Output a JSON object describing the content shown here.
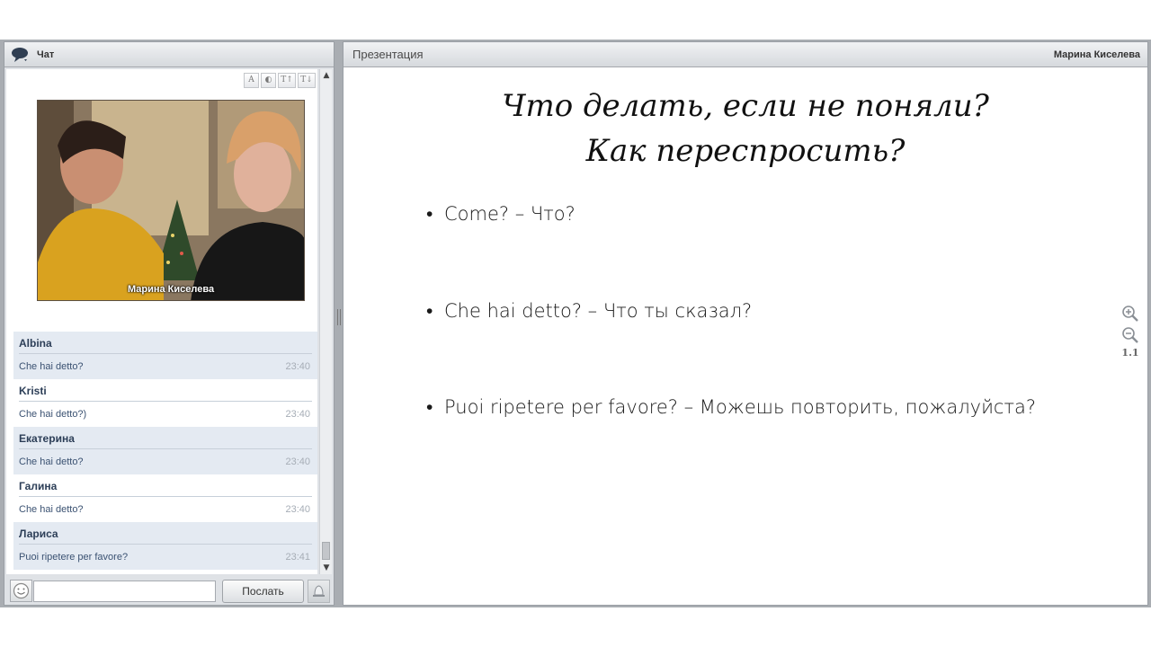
{
  "chat": {
    "title": "Чат",
    "tools": [
      "A",
      "◐",
      "T↑",
      "T↓"
    ],
    "video_name": "Марина Киселева",
    "messages": [
      {
        "author": "Albina",
        "text": "Che hai detto?",
        "time": "23:40"
      },
      {
        "author": "Kristi",
        "text": "Che hai detto?)",
        "time": "23:40"
      },
      {
        "author": "Екатерина",
        "text": "Che hai detto?",
        "time": "23:40"
      },
      {
        "author": "Галина",
        "text": "Che hai detto?",
        "time": "23:40"
      },
      {
        "author": "Лариса",
        "text": "Puoi ripetere per favore?",
        "time": "23:41"
      }
    ],
    "input_value": "",
    "send_label": "Послать",
    "icons": {
      "header": "speech-bubble-icon",
      "smiley": "smiley-icon",
      "bell": "bell-icon"
    }
  },
  "presentation": {
    "title": "Презентация",
    "presenter": "Марина Киселева",
    "slide": {
      "title_line1": "Что делать, если не поняли?",
      "title_line2": "Как переспросить?",
      "bullets": [
        "Come? – Что?",
        "Che hai detto? – Что ты сказал?",
        "Puoi ripetere per favore? – Можешь повторить, пожалуйста?"
      ]
    },
    "zoom_level": "1.1",
    "icons": {
      "zoom_in": "zoom-in-icon",
      "zoom_out": "zoom-out-icon"
    }
  }
}
